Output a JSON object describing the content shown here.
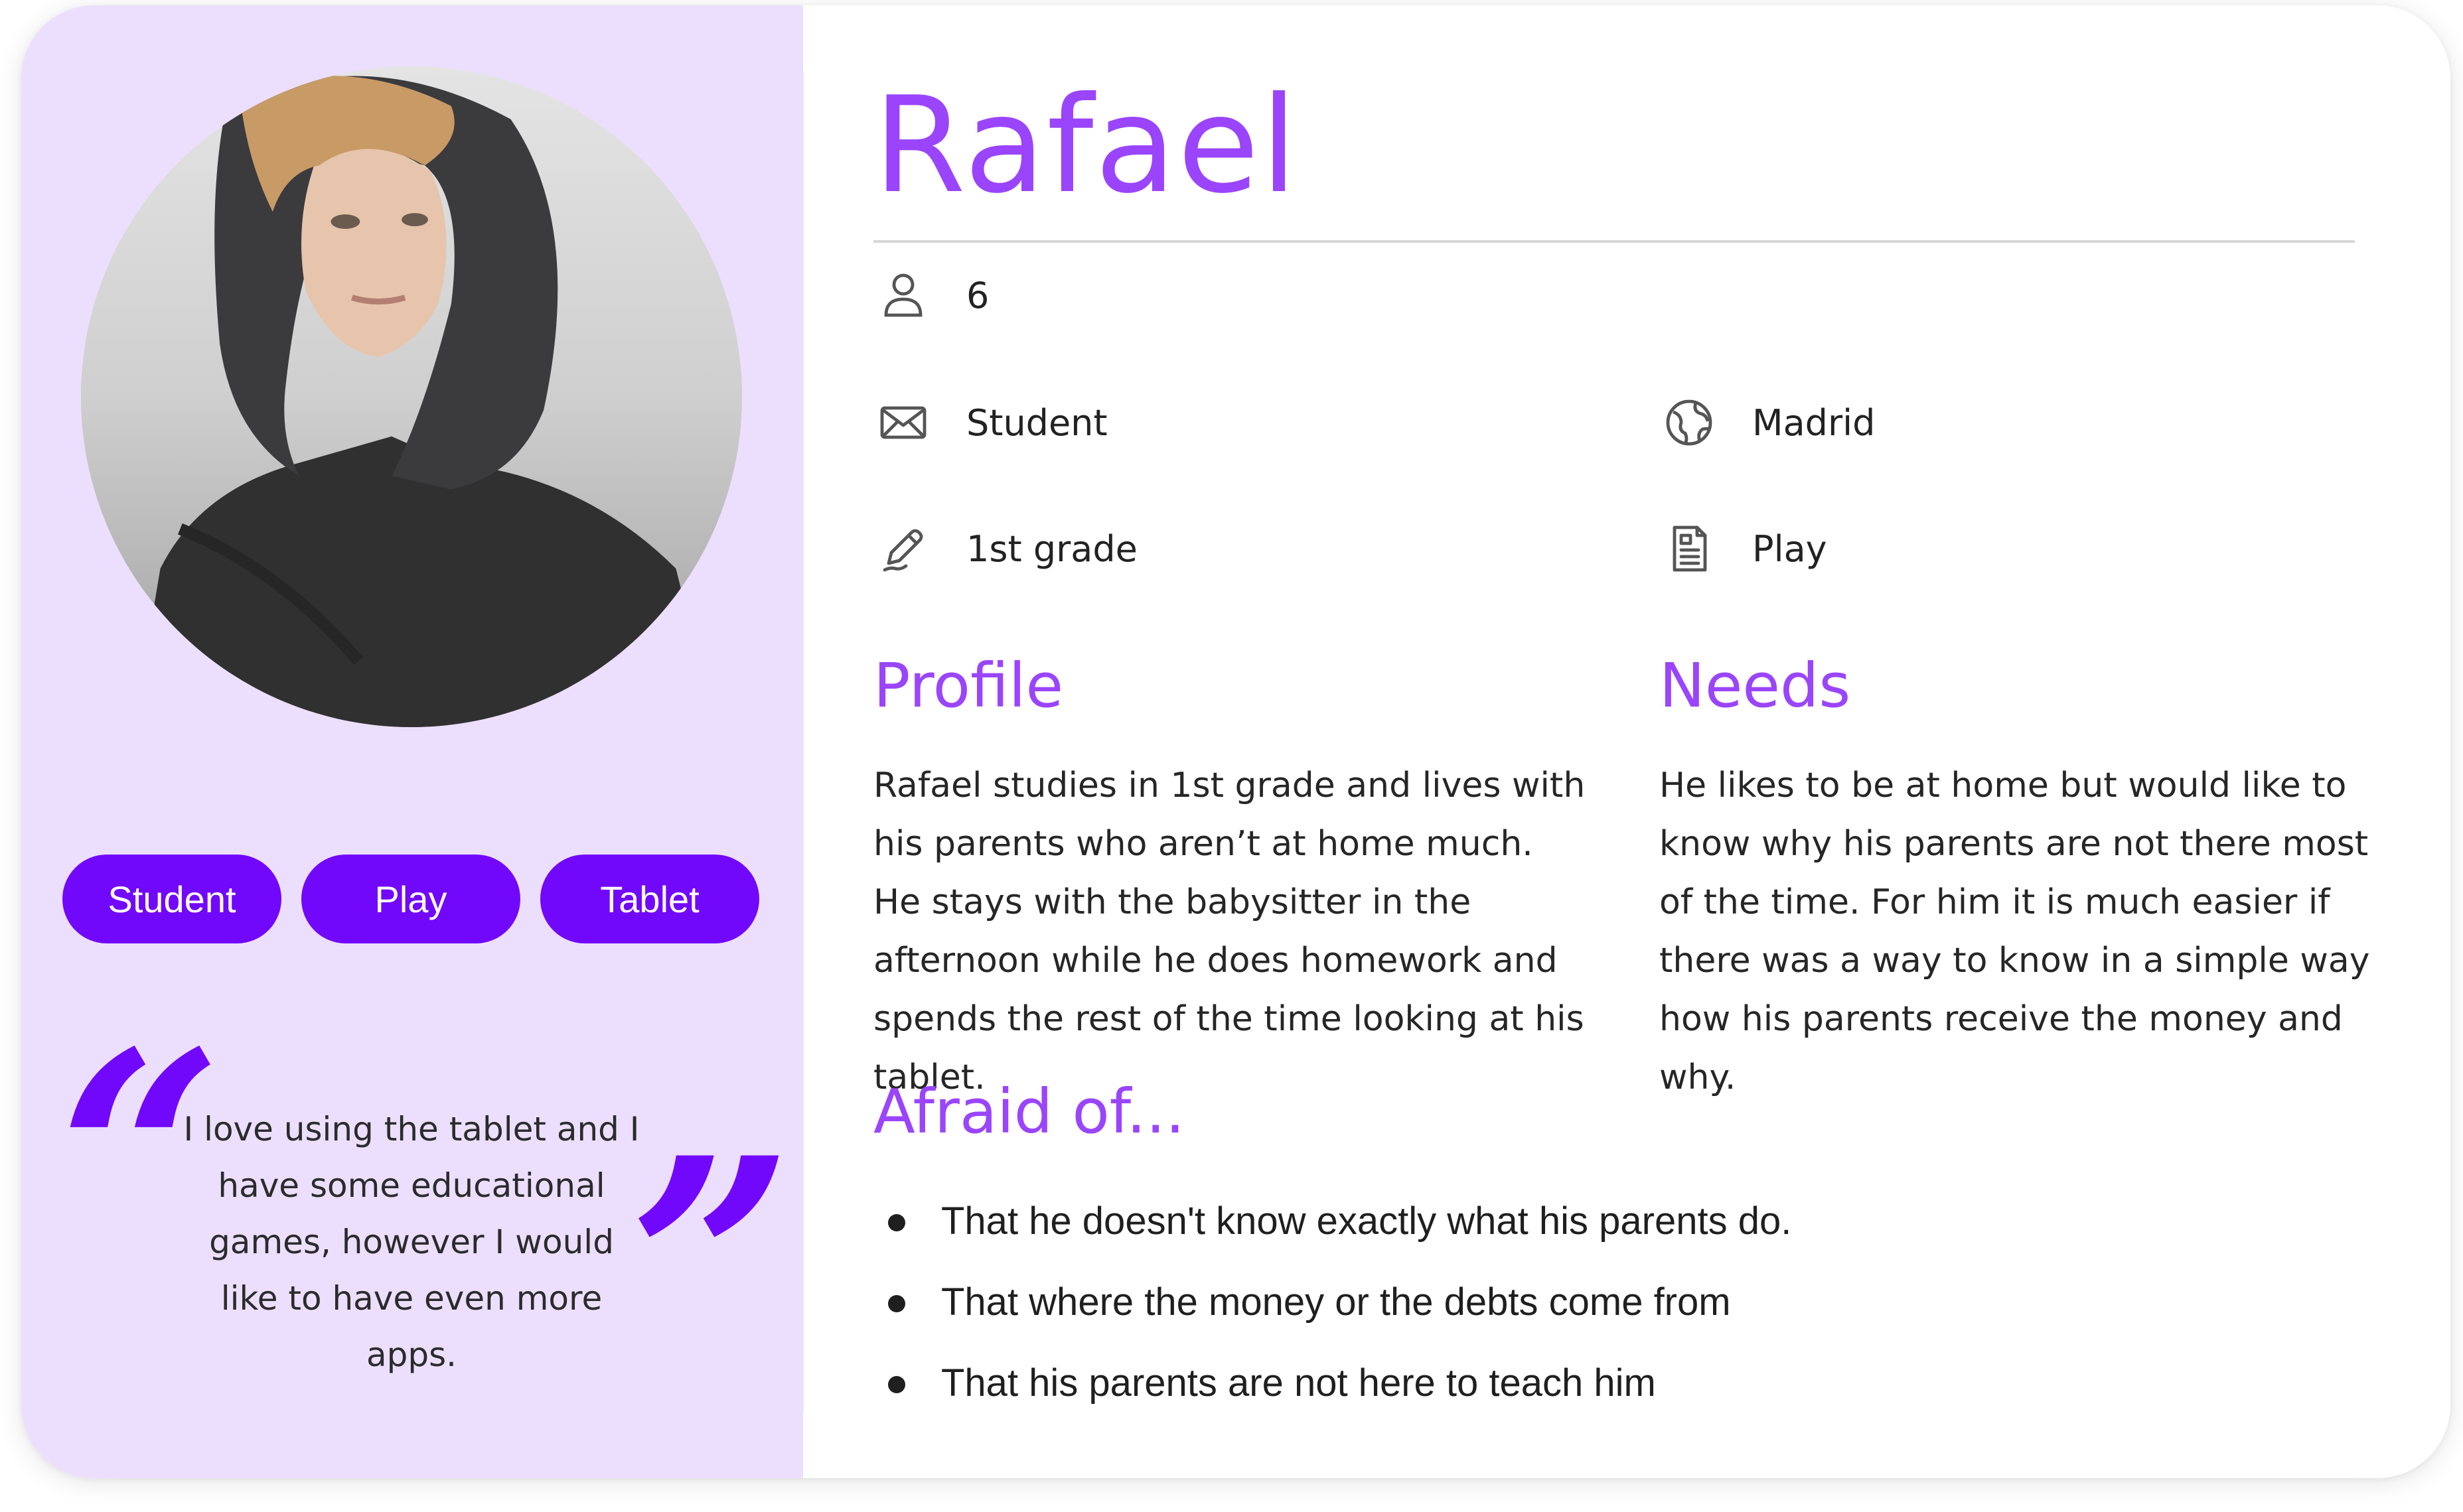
{
  "persona": {
    "name": "Rafael",
    "tags": [
      "Student",
      "Play",
      "Tablet"
    ],
    "quote": "I love using the tablet and I have some educational games, however I would like to have even more apps.",
    "quote_open": "“",
    "quote_close": "”"
  },
  "info": {
    "age": "6",
    "occupation": "Student",
    "location": "Madrid",
    "education": "1st grade",
    "interest": "Play"
  },
  "profile": {
    "title": "Profile",
    "text": "Rafael studies in 1st grade and lives with his parents who aren’t at home much. He stays with the babysitter in the afternoon while he does homework and spends the rest of the time looking at his tablet."
  },
  "needs": {
    "title": "Needs",
    "text": "He likes to be at home but would like to know why his parents are not there most of the time. For him it is much easier if there was a way to know in a simple way how his parents receive the money and why."
  },
  "afraid": {
    "title": "Afraid of...",
    "items": [
      "That he doesn't know exactly what his parents do.",
      "That where the money or the debts come from",
      "That his parents are not here to teach him"
    ]
  },
  "colors": {
    "accent": "#9a45fb",
    "chip": "#7208fb",
    "panel": "#ecdffe"
  },
  "icons": [
    "user-icon",
    "mail-icon",
    "globe-icon",
    "pen-icon",
    "document-icon"
  ]
}
